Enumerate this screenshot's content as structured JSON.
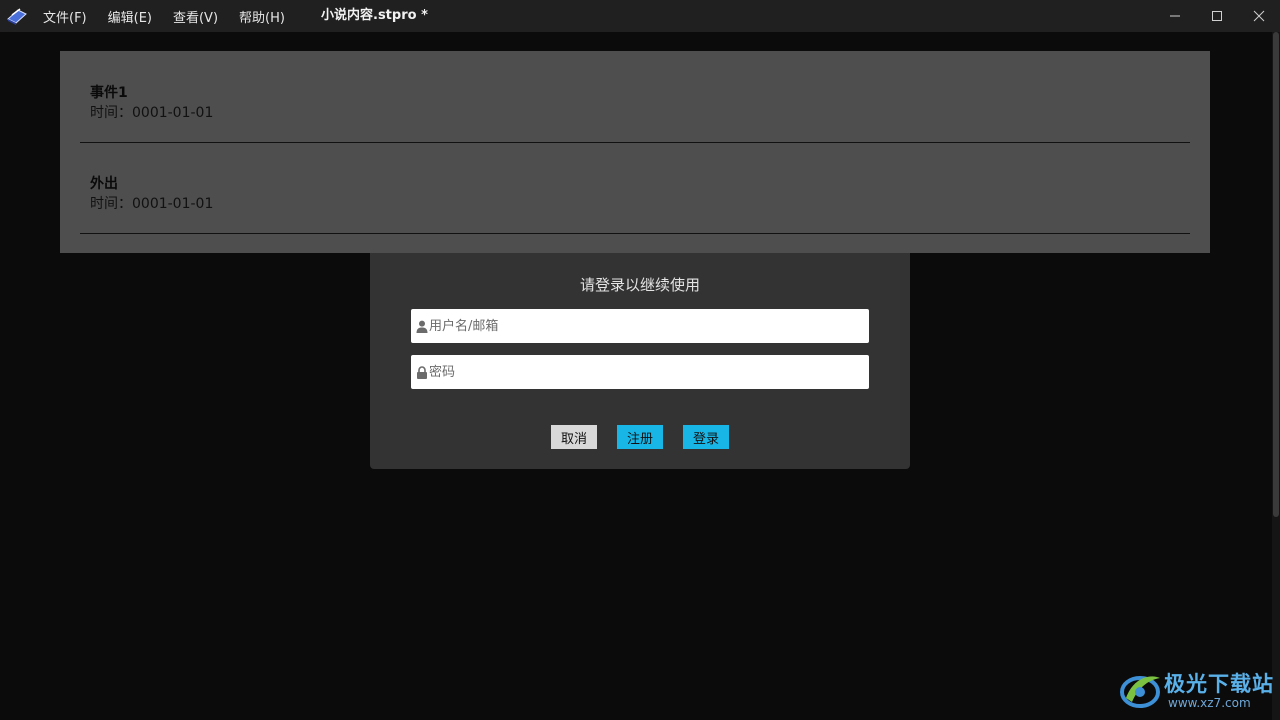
{
  "menu": {
    "file": "文件(F)",
    "edit": "编辑(E)",
    "view": "查看(V)",
    "help": "帮助(H)"
  },
  "window": {
    "title": "小说内容.stpro *"
  },
  "events": [
    {
      "title": "事件1",
      "time": "时间：0001-01-01"
    },
    {
      "title": "外出",
      "time": "时间：0001-01-01"
    }
  ],
  "dialog": {
    "title": "请登录以继续使用",
    "username_placeholder": "用户名/邮箱",
    "password_placeholder": "密码",
    "cancel_label": "取消",
    "register_label": "注册",
    "login_label": "登录"
  },
  "watermark": {
    "brand": "极光下载站",
    "url": "www.xz7.com"
  },
  "colors": {
    "accent": "#17b6e6",
    "dialog_bg": "#333333",
    "list_bg": "#4e4e4e"
  }
}
